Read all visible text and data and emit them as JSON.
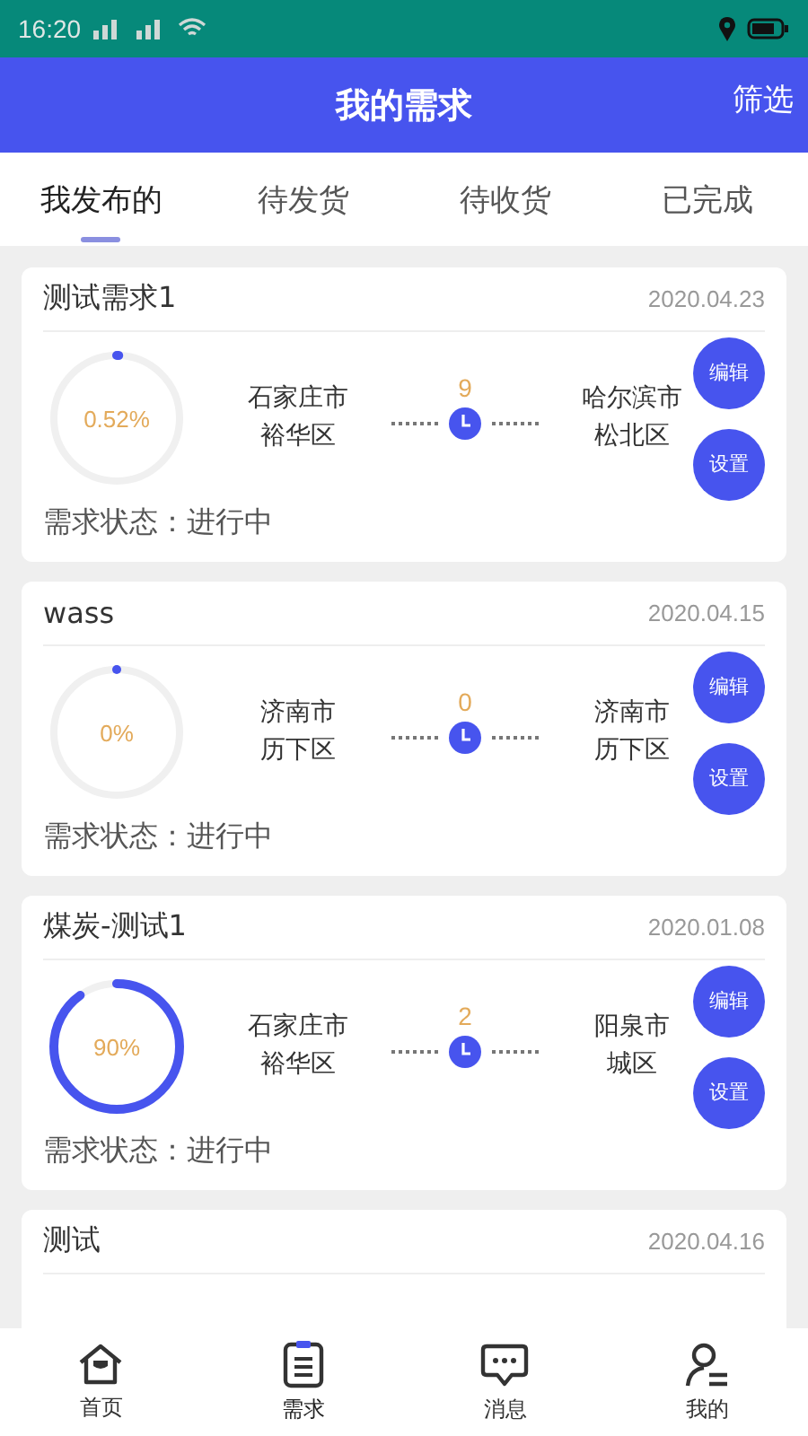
{
  "status_bar": {
    "time": "16:20"
  },
  "header": {
    "title": "我的需求",
    "action": "筛选"
  },
  "tabs": [
    {
      "label": "我发布的",
      "selected": true
    },
    {
      "label": "待发货",
      "selected": false
    },
    {
      "label": "待收货",
      "selected": false
    },
    {
      "label": "已完成",
      "selected": false
    }
  ],
  "cards": [
    {
      "title": "测试需求1",
      "date": "2020.04.23",
      "level": 0.0052,
      "percent": "0.52%",
      "from": [
        "石家庄市",
        "裕华区"
      ],
      "count": "9",
      "to": [
        "哈尔滨市",
        "松北区"
      ],
      "buttons": [
        "编辑",
        "设置"
      ],
      "status": "需求状态：进行中"
    },
    {
      "title": "wass",
      "date": "2020.04.15",
      "level": 0,
      "percent": "0%",
      "from": [
        "济南市",
        "历下区"
      ],
      "count": "0",
      "to": [
        "济南市",
        "历下区"
      ],
      "buttons": [
        "编辑",
        "设置"
      ],
      "status": "需求状态：进行中"
    },
    {
      "title": "煤炭-测试1",
      "date": "2020.01.08",
      "level": 0.9,
      "percent": "90%",
      "from": [
        "石家庄市",
        "裕华区"
      ],
      "count": "2",
      "to": [
        "阳泉市",
        "城区"
      ],
      "buttons": [
        "编辑",
        "设置"
      ],
      "status": "需求状态：进行中"
    },
    {
      "title": "测试",
      "date": "2020.04.16"
    }
  ],
  "bottom_nav": [
    {
      "label": "首页",
      "selected": false
    },
    {
      "label": "需求",
      "selected": true
    },
    {
      "label": "消息",
      "selected": false
    },
    {
      "label": "我的",
      "selected": false
    }
  ]
}
